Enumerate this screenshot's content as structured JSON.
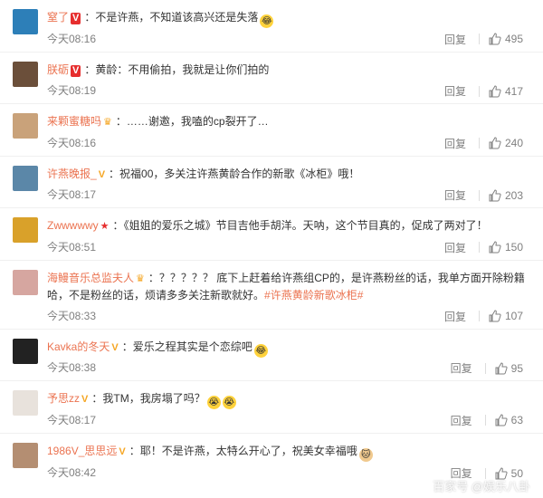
{
  "comments": [
    {
      "user": "窒了",
      "badge": "V",
      "badge_style": "red",
      "sep": "：",
      "text": "不是许燕，不知道该高兴还是失落",
      "emoji": "laugh-cry",
      "time": "今天08:16",
      "reply": "回复",
      "likes": "495",
      "avatar_color": "#2d7fb8"
    },
    {
      "user": "朕砺",
      "badge": "V",
      "badge_style": "red",
      "sep": "：",
      "text": "黄龄：不用偷拍，我就是让你们拍的",
      "emoji": "",
      "time": "今天08:19",
      "reply": "回复",
      "likes": "417",
      "avatar_color": "#6b4f3a"
    },
    {
      "user": "来颗蜜糖吗",
      "badge": "crown",
      "badge_style": "gold",
      "sep": "：",
      "text": "……谢邀，我嗑的cp裂开了…",
      "emoji": "",
      "time": "今天08:16",
      "reply": "回复",
      "likes": "240",
      "avatar_color": "#c9a27a"
    },
    {
      "user": "许燕晚报_",
      "badge": "V",
      "badge_style": "gold",
      "sep": "：",
      "text": "祝福00，多关注许燕黄龄合作的新歌《冰柜》哦！",
      "emoji": "",
      "time": "今天08:17",
      "reply": "回复",
      "likes": "203",
      "avatar_color": "#5b87a8"
    },
    {
      "user": "Zwwwwwy",
      "badge": "★",
      "badge_style": "red",
      "sep": "：",
      "text": "《姐姐的爱乐之城》节目吉他手胡洋。天呐，这个节目真的，促成了两对了！",
      "emoji": "",
      "time": "今天08:51",
      "reply": "回复",
      "likes": "150",
      "avatar_color": "#d9a12a"
    },
    {
      "user": "海鳗音乐总监夫人",
      "badge": "crown",
      "badge_style": "gold",
      "sep": "：",
      "text": "？？？？？ 底下上赶着给许燕组CP的，是许燕粉丝的话，我单方面开除粉籍哈，不是粉丝的话，烦请多多关注新歌就好。",
      "tag": "#许燕黄龄新歌冰柜#",
      "emoji": "",
      "time": "今天08:33",
      "reply": "回复",
      "likes": "107",
      "avatar_color": "#d6a6a0"
    },
    {
      "user": "Kavka的冬天",
      "badge": "V",
      "badge_style": "gold",
      "sep": "：",
      "text": "爱乐之程其实是个恋综吧",
      "emoji": "laugh-cry",
      "time": "今天08:38",
      "reply": "回复",
      "likes": "95",
      "avatar_color": "#222222"
    },
    {
      "user": "予思zz",
      "badge": "V",
      "badge_style": "gold",
      "sep": "：",
      "text": "我TM，我房塌了吗？",
      "emoji": "cry",
      "time": "今天08:17",
      "reply": "回复",
      "likes": "63",
      "avatar_color": "#e8e2dc"
    },
    {
      "user": "1986V_思思远",
      "badge": "V",
      "badge_style": "gold",
      "sep": "：",
      "text": "耶！不是许燕，太特么开心了，祝美女幸福哦",
      "emoji": "cat",
      "time": "今天08:42",
      "reply": "回复",
      "likes": "50",
      "avatar_color": "#b48e72"
    }
  ],
  "watermark": "百家号 @娱乐八卦",
  "icons": {
    "like": "thumb-up-icon"
  }
}
